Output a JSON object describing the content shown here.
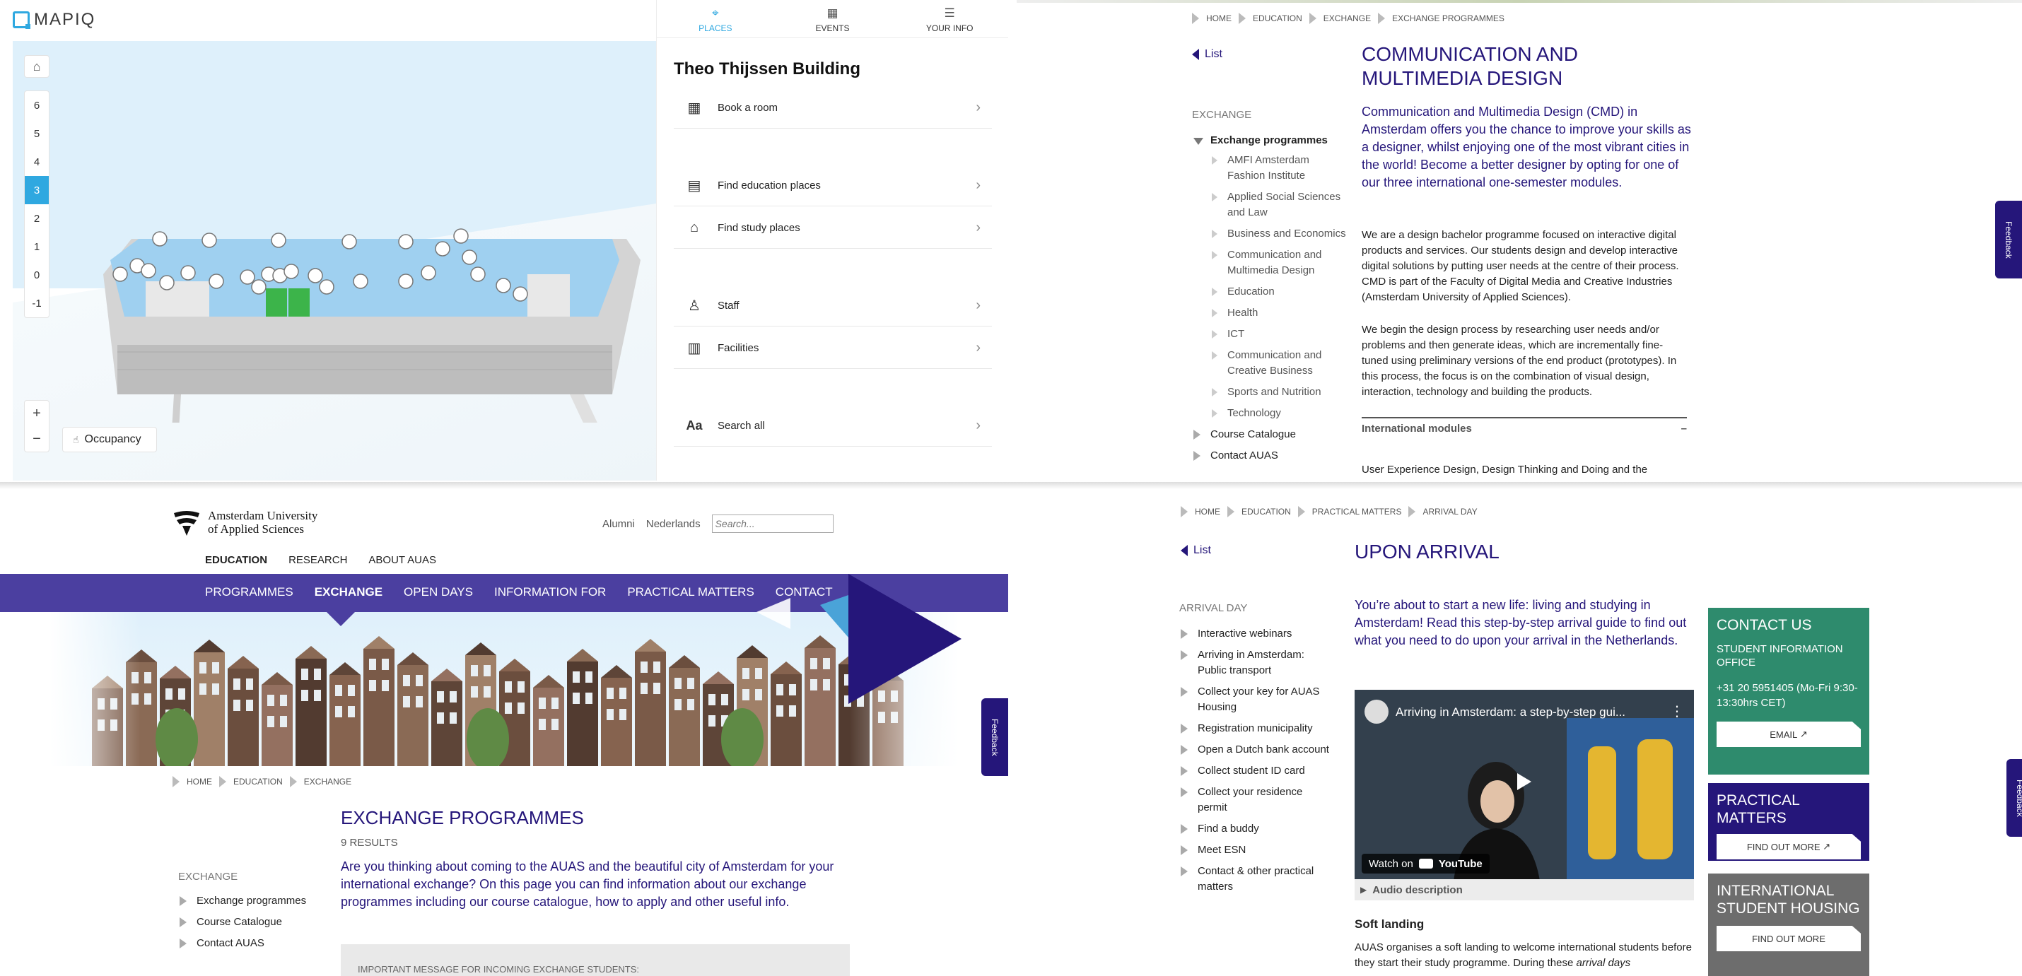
{
  "mapiq": {
    "logo": "MAPIQ",
    "floors": [
      "6",
      "5",
      "4",
      "3",
      "2",
      "1",
      "0",
      "-1"
    ],
    "active_floor": "3",
    "zoom_in": "+",
    "zoom_out": "−",
    "occupancy_label": "Occupancy",
    "tabs": [
      {
        "label": "PLACES",
        "icon": "map-pin-icon"
      },
      {
        "label": "EVENTS",
        "icon": "calendar-icon"
      },
      {
        "label": "YOUR INFO",
        "icon": "profile-list-icon"
      }
    ],
    "active_tab": "PLACES",
    "building": "Theo Thijssen Building",
    "menu": [
      {
        "label": "Book a room",
        "icon": "calendar-icon"
      },
      {
        "label": "Find education places",
        "icon": "classroom-icon"
      },
      {
        "label": "Find study places",
        "icon": "study-desk-icon"
      },
      {
        "label": "Staff",
        "icon": "person-icon"
      },
      {
        "label": "Facilities",
        "icon": "building-icon"
      },
      {
        "label": "Search all",
        "icon": "text-search-icon"
      }
    ],
    "search_all_glyph": "Aa",
    "colors": {
      "accent": "#2fa8e0",
      "room": "#8cc8ee",
      "green_room": "#3cb44a"
    }
  },
  "cmd_page": {
    "breadcrumbs": [
      "HOME",
      "EDUCATION",
      "EXCHANGE",
      "EXCHANGE PROGRAMMES"
    ],
    "back": "List",
    "side_heading": "EXCHANGE",
    "side_open": "Exchange programmes",
    "side_sub": [
      "AMFI Amsterdam Fashion Institute",
      "Applied Social Sciences and Law",
      "Business and Economics",
      "Communication and Multimedia Design",
      "Education",
      "Health",
      "ICT",
      "Communication and Creative Business",
      "Sports and Nutrition",
      "Technology"
    ],
    "side_after": [
      "Course Catalogue",
      "Contact AUAS"
    ],
    "title": "COMMUNICATION AND MULTIMEDIA DESIGN",
    "intro": "Communication and Multimedia Design (CMD) in Amsterdam offers you the chance to improve your skills as a designer, whilst enjoying one of the most vibrant cities in the world! Become a better designer by opting for one of our three international one-semester modules.",
    "para1": "We are a design bachelor programme focused on interactive digital products and services. Our students design and develop interactive digital solutions by putting user needs at the centre of their process. CMD is part of the Faculty of Digital Media and Creative Industries (Amsterdam University of Applied Sciences).",
    "para2": "We begin the design process by researching user needs and/or problems and then generate ideas, which are incrementally fine-tuned using preliminary versions of the end product (prototypes). In this process, the focus is on the combination of visual design, interaction, technology and building the products.",
    "accordion": "International modules",
    "accordion_toggle": "–",
    "para3": "User Experience Design, Design Thinking and Doing and the",
    "feedback": "Feedback"
  },
  "exchange_page": {
    "logo_line1": "Amsterdam University",
    "logo_line2": "of Applied Sciences",
    "top_links": [
      "Alumni",
      "Nederlands"
    ],
    "search_placeholder": "Search...",
    "main_nav": [
      "EDUCATION",
      "RESEARCH",
      "ABOUT AUAS"
    ],
    "sub_nav": [
      "PROGRAMMES",
      "EXCHANGE",
      "OPEN DAYS",
      "INFORMATION FOR",
      "PRACTICAL MATTERS",
      "CONTACT"
    ],
    "breadcrumbs": [
      "HOME",
      "EDUCATION",
      "EXCHANGE"
    ],
    "title": "EXCHANGE PROGRAMMES",
    "results": "9 RESULTS",
    "intro": "Are you thinking about coming to the AUAS and the beautiful city of Amsterdam for your international exchange? On this page you can find information about our exchange programmes including our course catalogue, how to apply and other useful info.",
    "side_heading": "EXCHANGE",
    "side": [
      "Exchange programmes",
      "Course Catalogue",
      "Contact AUAS"
    ],
    "message": "IMPORTANT MESSAGE FOR INCOMING EXCHANGE STUDENTS:",
    "feedback": "Feedback",
    "colors": {
      "purple": "#4b3fa0",
      "navy": "#25167a",
      "sky": "#4aa3d8"
    }
  },
  "arrival_page": {
    "breadcrumbs": [
      "HOME",
      "EDUCATION",
      "PRACTICAL MATTERS",
      "ARRIVAL DAY"
    ],
    "back": "List",
    "side_heading": "ARRIVAL DAY",
    "side": [
      "Interactive webinars",
      "Arriving in Amsterdam: Public transport",
      "Collect your key for AUAS Housing",
      "Registration municipality",
      "Open a Dutch bank account",
      "Collect student ID card",
      "Collect your residence permit",
      "Find a buddy",
      "Meet ESN",
      "Contact & other practical matters"
    ],
    "title": "UPON ARRIVAL",
    "intro": "You’re about to start a new life: living and studying in Amsterdam! Read this step-by-step arrival guide to find out what you need to do upon your arrival in the Netherlands.",
    "video_title": "Arriving in Amsterdam: a step-by-step gui...",
    "watch_on": "Watch on",
    "youtube": "YouTube",
    "audio_desc": "Audio description",
    "soft_landing": "Soft landing",
    "soft_text": "AUAS organises a soft landing to welcome international students before they start their study programme. During these",
    "soft_text_em": "arrival days",
    "contact": {
      "title": "CONTACT US",
      "sub": "STUDENT INFORMATION OFFICE",
      "phone": "+31 20 5951405 (Mo-Fri 9:30-13:30hrs CET)",
      "button": "EMAIL"
    },
    "practical": {
      "title": "PRACTICAL MATTERS",
      "button": "FIND OUT MORE"
    },
    "housing": {
      "title": "INTERNATIONAL STUDENT HOUSING",
      "button": "FIND OUT MORE"
    },
    "feedback": "Feedback",
    "colors": {
      "green": "#2e8b6d",
      "navy": "#25167a",
      "grey": "#6d6d6d"
    }
  }
}
